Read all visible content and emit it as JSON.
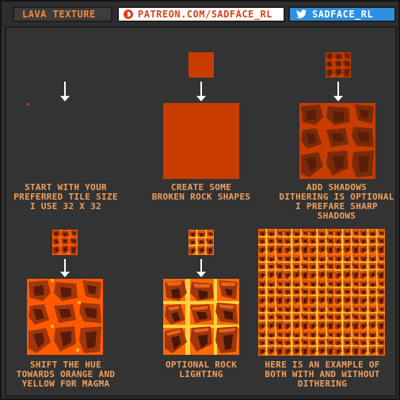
{
  "header": {
    "title": "LAVA TEXTURE",
    "patreon": "PATREON.COM/SADFACE_RL",
    "twitter": "SADFACE_RL"
  },
  "steps": [
    {
      "caption": "START WITH YOUR\nPREFERRED TILE SIZE\nI USE 32 X 32"
    },
    {
      "caption": "CREATE SOME\nBROKEN ROCK SHAPES"
    },
    {
      "caption": "ADD SHADOWS\nDITHERING IS OPTIONAL\nI PREFARE SHARP\nSHADOWS"
    },
    {
      "caption": "SHIFT THE HUE\nTOWARDS ORANGE AND\nYELLOW FOR MAGMA"
    },
    {
      "caption": "OPTIONAL ROCK\nLIGHTING"
    },
    {
      "caption": "HERE IS AN EXAMPLE OF\nBOTH WITH AND WITHOUT\nDITHERING"
    }
  ],
  "colors": {
    "background": "#333333",
    "caption": "#f0a060",
    "lava_red": "#c83c00",
    "rock_dark": "#7a2a08",
    "magma_orange": "#ff7a1a",
    "magma_yellow": "#ffd040",
    "twitter_blue": "#2d8fe0"
  },
  "icons": {
    "patreon": "patreon-icon",
    "twitter": "twitter-bird-icon",
    "arrow": "arrow-down-icon"
  }
}
